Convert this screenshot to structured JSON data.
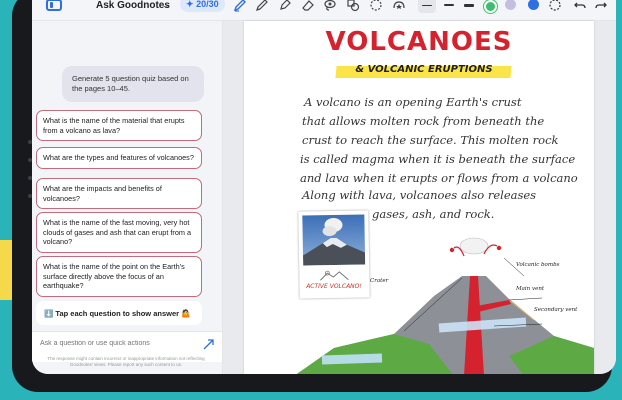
{
  "toolbar": {
    "title": "Ask Goodnotes",
    "chevron": "⌄",
    "quota": "20/30",
    "quota_icon": "✦",
    "tools": [
      "pen-icon",
      "pencil-icon",
      "highlighter-icon",
      "eraser-icon",
      "lasso-icon",
      "shapes-icon",
      "elements-icon",
      "ai-sparkle-icon"
    ],
    "colors": {
      "black": "#111111",
      "green": "#3bbf6b",
      "lavender": "#c4bfe0",
      "blue": "#2f6fe0"
    }
  },
  "panel": {
    "prompt": "Generate 5 question quiz based on the pages 10–45.",
    "questions": [
      "What is the name of the material that erupts from a volcano as lava?",
      "What are the types and features of volcanoes?",
      "What are the impacts and benefits of volcanoes?",
      "What is the name of the fast moving, very hot clouds of gases and ash that can erupt from a volcano?",
      "What is the name of the point on the Earth's surface directly above the focus of an earthquake?"
    ],
    "hint": "⬇️ Tap each question to show answer 🤷",
    "input_placeholder": "Ask a question or use quick actions",
    "disclaimer": "The response might contain incorrect or inappropriate information not reflecting Goodnotes' views. Please report any such content to us."
  },
  "notebook": {
    "title": "VOLCANOES",
    "subtitle": "& VOLCANIC ERUPTIONS",
    "lines": [
      "A  volcano is an opening Earth's crust",
      "that allows molten rock from beneath the",
      "crust to reach the surface. This molten rock",
      "is called magma when it is beneath the surface",
      "and lava when it erupts or flows from a volcano",
      "Along with lava, volcanoes also releases",
      "gases, ash, and rock."
    ],
    "photo_caption": "ACTIVE VOLCANO!",
    "labels": {
      "crater": "Crater",
      "bombs": "Volcanic bombs",
      "main_vent": "Main vent",
      "secondary_vent": "Secondary vent"
    }
  }
}
